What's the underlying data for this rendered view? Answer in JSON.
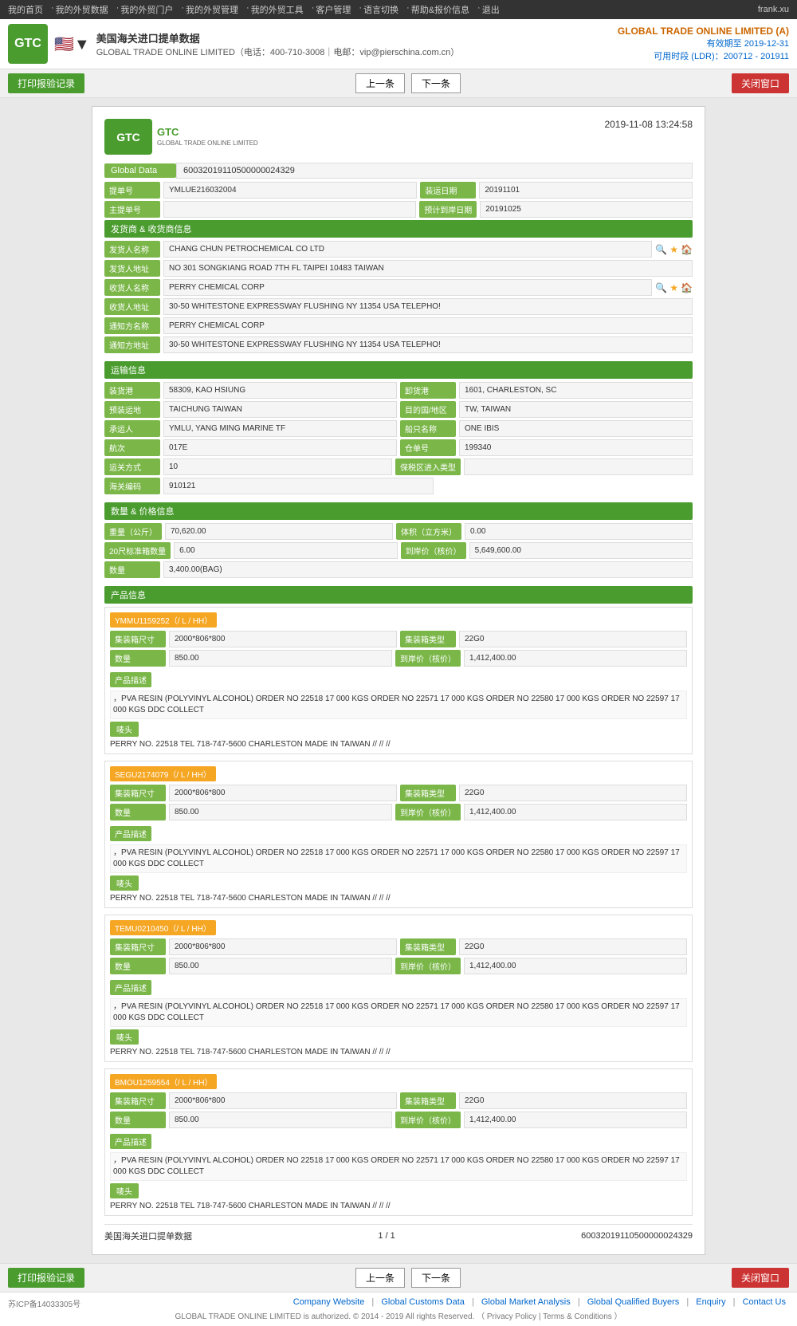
{
  "topnav": {
    "items": [
      "我的首页",
      "我的外贸数据",
      "我的外贸门户",
      "我的外贸管理",
      "我的外贸工具",
      "客户管理",
      "语言切换",
      "帮助&报价信息",
      "退出"
    ],
    "user": "frank.xu"
  },
  "header": {
    "logo_text": "GTC",
    "title": "美国海关进口提单数据",
    "subtitle": "GLOBAL TRADE ONLINE LIMITED（电话：400-710-3008｜电邮：vip@pierschina.com.cn）",
    "company": "GLOBAL TRADE ONLINE LIMITED (A)",
    "expire": "有效期至 2019-12-31",
    "ldr": "可用时段 (LDR)：200712 - 201911"
  },
  "toolbar": {
    "print_btn": "打印报验记录",
    "prev_btn": "上一条",
    "next_btn": "下一条",
    "close_btn": "关闭窗口"
  },
  "doc": {
    "logo_text": "GTC",
    "logo_sub": "GLOBAL TRADE ONLINE LIMITED",
    "date": "2019-11-08 13:24:58",
    "global_data_label": "Global Data",
    "global_data_value": "60032019110500000024329",
    "bill_no_label": "提单号",
    "bill_no_value": "YMLUE216032004",
    "ship_date_label": "装运日期",
    "ship_date_value": "20191101",
    "master_bill_label": "主提单号",
    "master_bill_value": "",
    "est_arrive_label": "预计到岸日期",
    "est_arrive_value": "20191025"
  },
  "shipper": {
    "section_title": "发货商 & 收货商信息",
    "shipper_name_label": "发货人名称",
    "shipper_name_value": "CHANG CHUN PETROCHEMICAL CO LTD",
    "shipper_addr_label": "发货人地址",
    "shipper_addr_value": "NO 301 SONGKIANG ROAD 7TH FL TAIPEI 10483 TAIWAN",
    "consignee_name_label": "收货人名称",
    "consignee_name_value": "PERRY CHEMICAL CORP",
    "consignee_addr_label": "收货人地址",
    "consignee_addr_value": "30-50 WHITESTONE EXPRESSWAY FLUSHING NY 11354 USA TELEPHO!",
    "notify_label": "通知方名称",
    "notify_value": "PERRY CHEMICAL CORP",
    "notify_addr_label": "通知方地址",
    "notify_addr_value": "30-50 WHITESTONE EXPRESSWAY FLUSHING NY 11354 USA TELEPHO!"
  },
  "transport": {
    "section_title": "运输信息",
    "load_port_label": "装货港",
    "load_port_value": "58309, KAO HSIUNG",
    "discharge_port_label": "卸货港",
    "discharge_port_value": "1601, CHARLESTON, SC",
    "pre_carrier_label": "预装运地",
    "pre_carrier_value": "TAICHUNG TAIWAN",
    "destination_label": "目的国/地区",
    "destination_value": "TW, TAIWAN",
    "carrier_label": "承运人",
    "carrier_value": "YMLU, YANG MING MARINE TF",
    "vessel_label": "船只名称",
    "vessel_value": "ONE IBIS",
    "voyage_label": "航次",
    "voyage_value": "017E",
    "warehouse_label": "仓单号",
    "warehouse_value": "199340",
    "trade_mode_label": "运关方式",
    "trade_mode_value": "10",
    "bond_type_label": "保税区进入类型",
    "bond_type_value": "",
    "customs_no_label": "海关编码",
    "customs_no_value": "910121"
  },
  "price": {
    "section_title": "数量 & 价格信息",
    "weight_label": "重量（公斤）",
    "weight_value": "70,620.00",
    "volume_label": "体积（立方米）",
    "volume_value": "0.00",
    "container20_label": "20尺标准箱数量",
    "container20_value": "6.00",
    "declared_price_label": "到岸价（核价）",
    "declared_price_value": "5,649,600.00",
    "quantity_label": "数量",
    "quantity_value": "3,400.00(BAG)"
  },
  "products": {
    "section_title": "产品信息",
    "items": [
      {
        "container_no": "YMMU1159252（/ L / HH）",
        "size_label": "集装箱尺寸",
        "size_value": "2000*806*800",
        "type_label": "集装箱类型",
        "type_value": "22G0",
        "qty_label": "数量",
        "qty_value": "850.00",
        "price_label": "到岸价（核价）",
        "price_value": "1,412,400.00",
        "desc_title": "产品描述",
        "desc_text": "，PVA RESIN (POLYVINYL ALCOHOL) ORDER NO 22518 17 000 KGS ORDER NO 22571 17 000 KGS ORDER NO 22580 17 000 KGS ORDER NO 22597 17 000 KGS DDC COLLECT",
        "tangou_label": "唛头",
        "tangou_text": "PERRY NO. 22518 TEL 718-747-5600 CHARLESTON MADE IN TAIWAN // // //"
      },
      {
        "container_no": "SEGU2174079（/ L / HH）",
        "size_label": "集装箱尺寸",
        "size_value": "2000*806*800",
        "type_label": "集装箱类型",
        "type_value": "22G0",
        "qty_label": "数量",
        "qty_value": "850.00",
        "price_label": "到岸价（核价）",
        "price_value": "1,412,400.00",
        "desc_title": "产品描述",
        "desc_text": "，PVA RESIN (POLYVINYL ALCOHOL) ORDER NO 22518 17 000 KGS ORDER NO 22571 17 000 KGS ORDER NO 22580 17 000 KGS ORDER NO 22597 17 000 KGS DDC COLLECT",
        "tangou_label": "唛头",
        "tangou_text": "PERRY NO. 22518 TEL 718-747-5600 CHARLESTON MADE IN TAIWAN // // //"
      },
      {
        "container_no": "TEMU0210450（/ L / HH）",
        "size_label": "集装箱尺寸",
        "size_value": "2000*806*800",
        "type_label": "集装箱类型",
        "type_value": "22G0",
        "qty_label": "数量",
        "qty_value": "850.00",
        "price_label": "到岸价（核价）",
        "price_value": "1,412,400.00",
        "desc_title": "产品描述",
        "desc_text": "，PVA RESIN (POLYVINYL ALCOHOL) ORDER NO 22518 17 000 KGS ORDER NO 22571 17 000 KGS ORDER NO 22580 17 000 KGS ORDER NO 22597 17 000 KGS DDC COLLECT",
        "tangou_label": "唛头",
        "tangou_text": "PERRY NO. 22518 TEL 718-747-5600 CHARLESTON MADE IN TAIWAN // // //"
      },
      {
        "container_no": "BMOU1259554（/ L / HH）",
        "size_label": "集装箱尺寸",
        "size_value": "2000*806*800",
        "type_label": "集装箱类型",
        "type_value": "22G0",
        "qty_label": "数量",
        "qty_value": "850.00",
        "price_label": "到岸价（核价）",
        "price_value": "1,412,400.00",
        "desc_title": "产品描述",
        "desc_text": "，PVA RESIN (POLYVINYL ALCOHOL) ORDER NO 22518 17 000 KGS ORDER NO 22571 17 000 KGS ORDER NO 22580 17 000 KGS ORDER NO 22597 17 000 KGS DDC COLLECT",
        "tangou_label": "唛头",
        "tangou_text": "PERRY NO. 22518 TEL 718-747-5600 CHARLESTON MADE IN TAIWAN // // //"
      }
    ]
  },
  "pagination": {
    "data_label": "美国海关进口提单数据",
    "page": "1 / 1",
    "doc_id": "60032019110500000024329"
  },
  "footer": {
    "beian": "苏ICP备14033305号",
    "links": [
      "Company Website",
      "Global Customs Data",
      "Global Market Analysis",
      "Global Qualified Buyers",
      "Enquiry",
      "Contact Us"
    ],
    "copyright": "GLOBAL TRADE ONLINE LIMITED is authorized. © 2014 - 2019 All rights Reserved.  （ Privacy Policy | Terms & Conditions ）"
  }
}
